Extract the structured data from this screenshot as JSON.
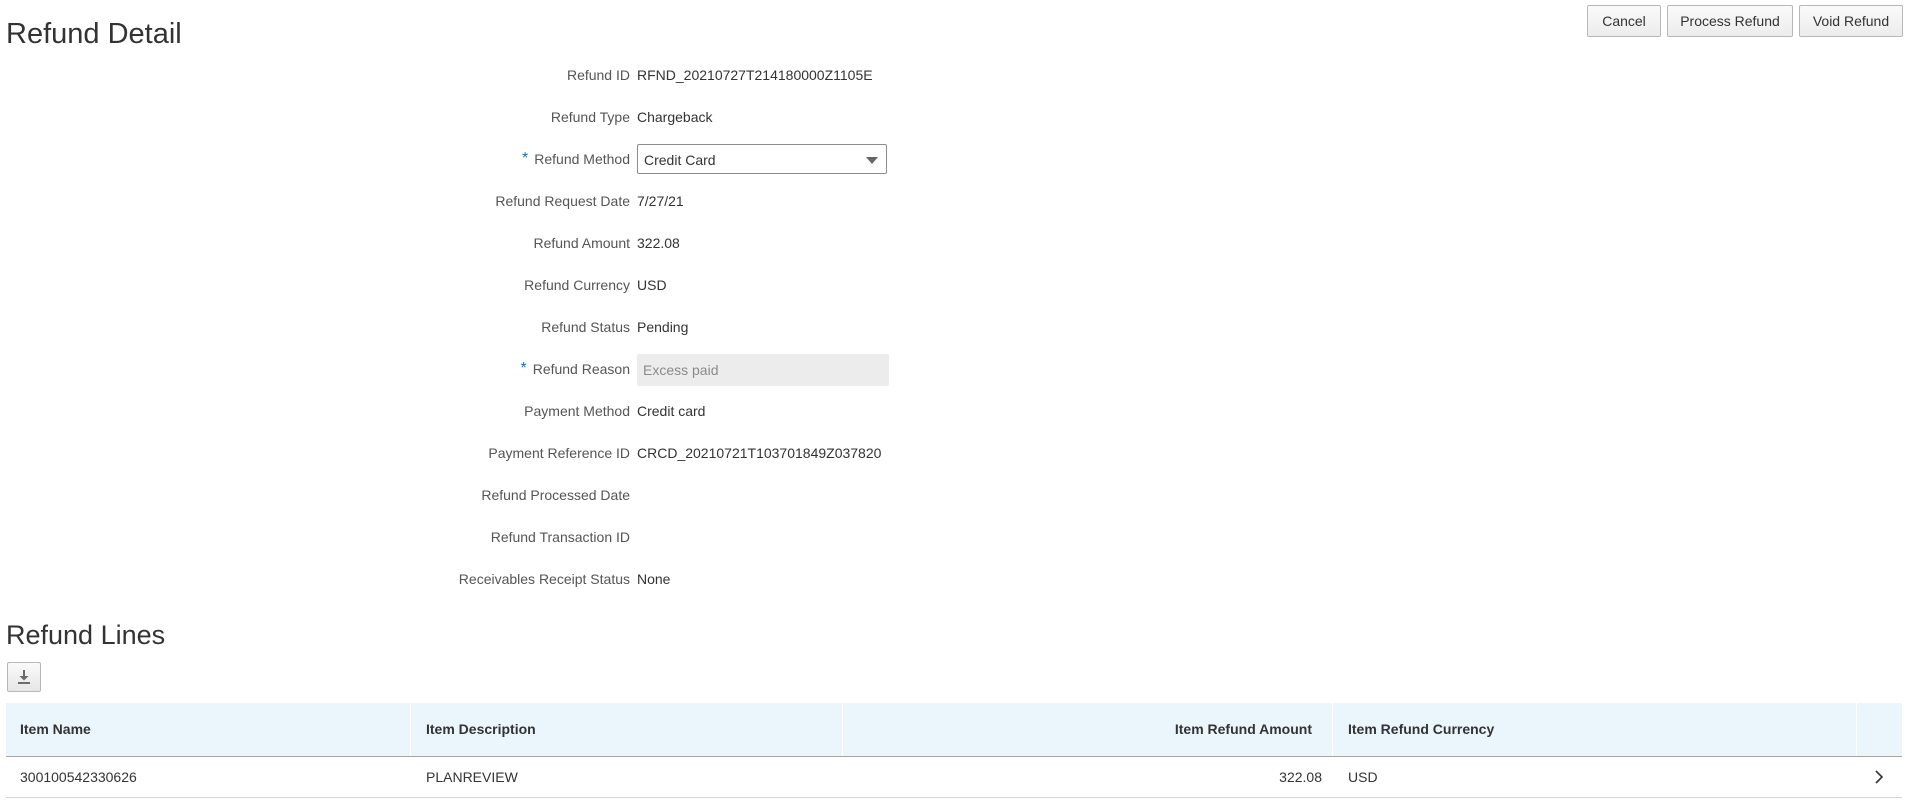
{
  "page": {
    "title": "Refund Detail"
  },
  "toolbar": {
    "cancel_label": "Cancel",
    "process_label": "Process Refund",
    "void_label": "Void Refund"
  },
  "form": {
    "refund_id": {
      "label": "Refund ID",
      "value": "RFND_20210727T214180000Z1105E"
    },
    "refund_type": {
      "label": "Refund Type",
      "value": "Chargeback"
    },
    "refund_method": {
      "label": "Refund Method",
      "value": "Credit Card",
      "required_mark": "*"
    },
    "refund_request_date": {
      "label": "Refund Request Date",
      "value": "7/27/21"
    },
    "refund_amount": {
      "label": "Refund Amount",
      "value": "322.08"
    },
    "refund_currency": {
      "label": "Refund Currency",
      "value": "USD"
    },
    "refund_status": {
      "label": "Refund Status",
      "value": "Pending"
    },
    "refund_reason": {
      "label": "Refund Reason",
      "value": "Excess paid",
      "required_mark": "*"
    },
    "payment_method": {
      "label": "Payment Method",
      "value": "Credit card"
    },
    "payment_reference_id": {
      "label": "Payment Reference ID",
      "value": "CRCD_20210721T103701849Z037820"
    },
    "refund_processed_date": {
      "label": "Refund Processed Date",
      "value": ""
    },
    "refund_transaction_id": {
      "label": "Refund Transaction ID",
      "value": ""
    },
    "receivables_receipt_status": {
      "label": "Receivables Receipt Status",
      "value": "None"
    }
  },
  "refund_lines": {
    "title": "Refund Lines",
    "export_icon": "download-icon",
    "columns": {
      "item_name": "Item Name",
      "item_description": "Item Description",
      "item_refund_amount": "Item Refund Amount",
      "item_refund_currency": "Item Refund Currency"
    },
    "rows": [
      {
        "item_name": "300100542330626",
        "item_description": "PLANREVIEW",
        "item_refund_amount": "322.08",
        "item_refund_currency": "USD"
      }
    ]
  },
  "colors": {
    "header_bg": "#eaf5fc",
    "required": "#1f6fb5",
    "readonly_bg": "#ececec"
  }
}
